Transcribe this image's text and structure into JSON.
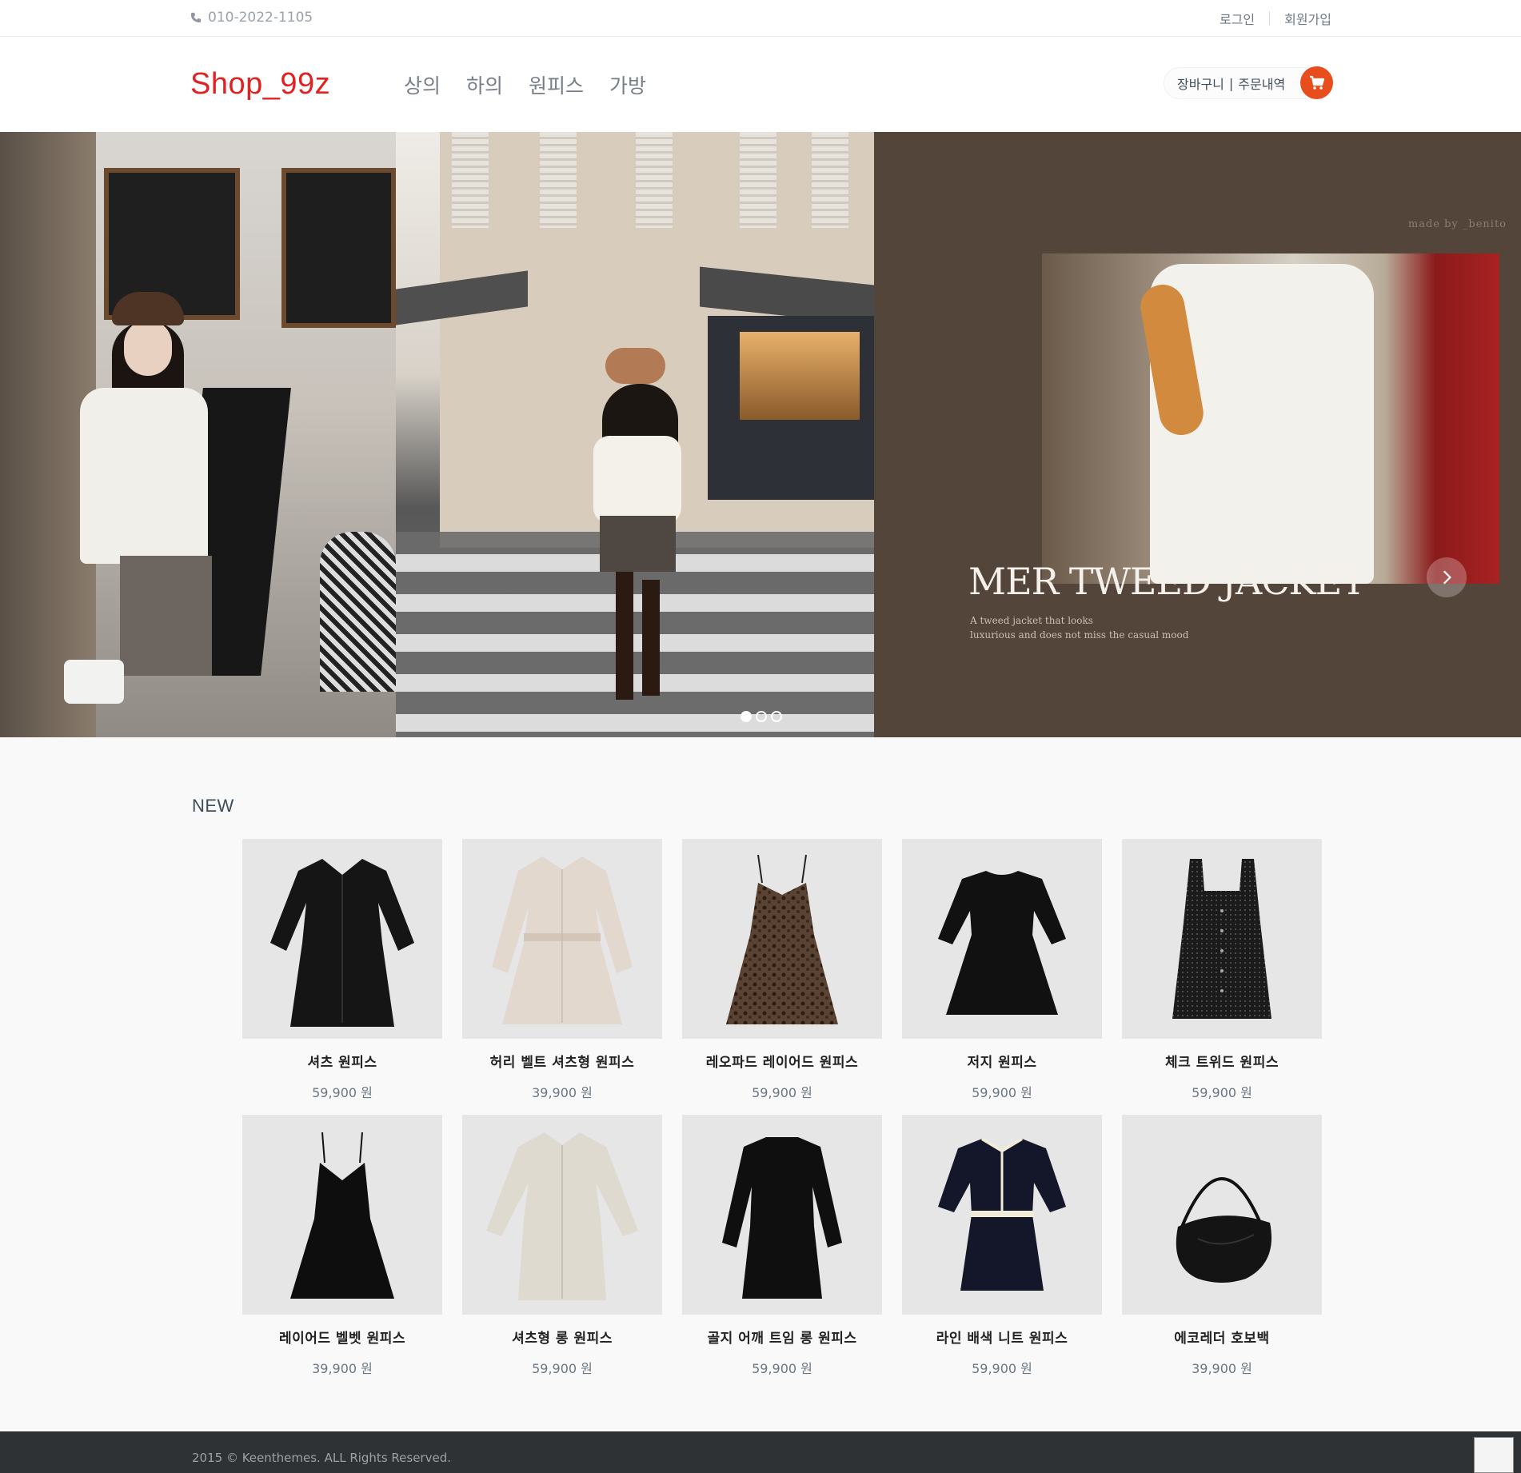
{
  "topbar": {
    "phone": "010-2022-1105",
    "login": "로그인",
    "signup": "회원가입"
  },
  "header": {
    "logo": "Shop_99z",
    "nav": [
      "상의",
      "하의",
      "원피스",
      "가방"
    ],
    "cart_label": "장바구니",
    "orders_label": "주문내역",
    "separator": "|",
    "accent_color": "#e84d1c",
    "logo_color": "#e02222"
  },
  "carousel": {
    "credit": "made by _benito",
    "headline": "MER TWEED JACKET",
    "sub_line1": "A tweed jacket that looks",
    "sub_line2": "luxurious and does not miss the casual mood",
    "slides_count": 3,
    "active_slide": 1
  },
  "section": {
    "title": "NEW"
  },
  "products": [
    {
      "name": "셔츠 원피스",
      "price": "59,900 원",
      "icon": "black-shirt-dress"
    },
    {
      "name": "허리 벨트 셔츠형 원피스",
      "price": "39,900 원",
      "icon": "beige-belted-dress"
    },
    {
      "name": "레오파드 레이어드 원피스",
      "price": "59,900 원",
      "icon": "leopard-slip-dress"
    },
    {
      "name": "저지 원피스",
      "price": "59,900 원",
      "icon": "black-jersey-dress"
    },
    {
      "name": "체크 트위드 원피스",
      "price": "59,900 원",
      "icon": "tweed-pinafore-dress"
    },
    {
      "name": "레이어드 벨벳 원피스",
      "price": "39,900 원",
      "icon": "velvet-slip-dress"
    },
    {
      "name": "셔츠형 롱 원피스",
      "price": "59,900 원",
      "icon": "ivory-long-shirt-dress"
    },
    {
      "name": "골지 어깨 트임 롱 원피스",
      "price": "59,900 원",
      "icon": "ribbed-long-dress"
    },
    {
      "name": "라인 배색 니트 원피스",
      "price": "59,900 원",
      "icon": "navy-knit-dress"
    },
    {
      "name": "에코레더 호보백",
      "price": "39,900 원",
      "icon": "hobo-bag"
    }
  ],
  "footer": {
    "copyright": "2015 © Keenthemes. ALL Rights Reserved."
  }
}
